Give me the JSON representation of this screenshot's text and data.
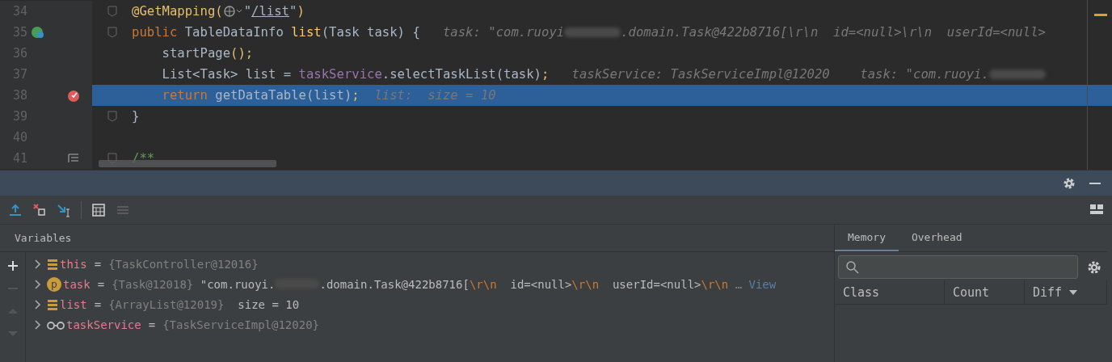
{
  "editor": {
    "lines": [
      {
        "number": "34",
        "kind": "plain",
        "fold": true,
        "current": false,
        "segments": [
          {
            "kind": "annotation",
            "text": "@GetMapping("
          },
          {
            "kind": "globe"
          },
          {
            "kind": "string",
            "text": "\""
          },
          {
            "kind": "link",
            "text": "/list"
          },
          {
            "kind": "string",
            "text": "\""
          },
          {
            "kind": "annotation",
            "text": ")"
          }
        ]
      },
      {
        "number": "35",
        "kind": "endpoint",
        "fold": true,
        "current": false,
        "segments": [
          {
            "kind": "keyword",
            "text": "public "
          },
          {
            "kind": "plain",
            "text": "TableDataInfo "
          },
          {
            "kind": "method",
            "text": "list"
          },
          {
            "kind": "plain",
            "text": "(Task task) "
          },
          {
            "kind": "brace",
            "text": "{"
          },
          {
            "kind": "hint",
            "text": "   task: \"com.ruoyi"
          },
          {
            "kind": "redacted"
          },
          {
            "kind": "hint",
            "text": ".domain.Task@422b8716[\\r\\n  id=<null>\\r\\n  userId=<null>"
          }
        ]
      },
      {
        "number": "36",
        "kind": "plain",
        "fold": false,
        "current": false,
        "segments": [
          {
            "kind": "plain",
            "text": "    startPage"
          },
          {
            "kind": "annotation",
            "text": "();"
          }
        ]
      },
      {
        "number": "37",
        "kind": "plain",
        "fold": false,
        "current": false,
        "segments": [
          {
            "kind": "plain",
            "text": "    List<Task> list = "
          },
          {
            "kind": "field",
            "text": "taskService"
          },
          {
            "kind": "plain",
            "text": ".selectTaskList(task)"
          },
          {
            "kind": "annotation",
            "text": ";"
          },
          {
            "kind": "hint",
            "text": "   taskService: TaskServiceImpl@12020    task: \"com.ruoyi."
          },
          {
            "kind": "redacted"
          }
        ]
      },
      {
        "number": "38",
        "kind": "breakpoint",
        "fold": false,
        "current": true,
        "segments": [
          {
            "kind": "keyword",
            "text": "    return "
          },
          {
            "kind": "plain",
            "text": "getDataTable(list)"
          },
          {
            "kind": "annotation",
            "text": ";"
          },
          {
            "kind": "hint",
            "text": "  list:  size = 10"
          }
        ]
      },
      {
        "number": "39",
        "kind": "plain",
        "fold": true,
        "current": false,
        "segments": [
          {
            "kind": "brace",
            "text": "}"
          }
        ]
      },
      {
        "number": "40",
        "kind": "plain",
        "fold": false,
        "current": false
      },
      {
        "number": "41",
        "kind": "doc",
        "fold": true,
        "current": false,
        "segments": [
          {
            "kind": "comment",
            "text": "/**"
          }
        ]
      }
    ]
  },
  "debug": {
    "variables_label": "Variables",
    "variables": [
      {
        "kind": "field",
        "name": "this",
        "equals": "=",
        "value": [
          {
            "kind": "ref",
            "text": "{TaskController@12016}"
          }
        ]
      },
      {
        "kind": "param",
        "badge": "p",
        "name": "task",
        "equals": "=",
        "value": [
          {
            "kind": "ref",
            "text": "{Task@12018}"
          },
          {
            "kind": "plain",
            "text": " \"com.ruoyi."
          },
          {
            "kind": "redacted"
          },
          {
            "kind": "plain",
            "text": ".domain.Task@422b8716["
          },
          {
            "kind": "escape",
            "text": "\\r\\n"
          },
          {
            "kind": "plain",
            "text": "  id=<null>"
          },
          {
            "kind": "escape",
            "text": "\\r\\n"
          },
          {
            "kind": "plain",
            "text": "  userId=<null>"
          },
          {
            "kind": "escape",
            "text": "\\r\\n"
          },
          {
            "kind": "ref",
            "text": " … "
          },
          {
            "kind": "link",
            "text": "View"
          }
        ]
      },
      {
        "kind": "field",
        "name": "list",
        "equals": "=",
        "value": [
          {
            "kind": "ref",
            "text": "{ArrayList@12019}"
          },
          {
            "kind": "plain",
            "text": "  size = 10"
          }
        ]
      },
      {
        "kind": "watch",
        "name": "taskService",
        "equals": "=",
        "value": [
          {
            "kind": "ref",
            "text": "{TaskServiceImpl@12020}"
          }
        ]
      }
    ],
    "memory": {
      "tabs": [
        {
          "label": "Memory",
          "selected": true
        },
        {
          "label": "Overhead",
          "selected": false
        }
      ],
      "columns": [
        {
          "label": "Class",
          "sort": false
        },
        {
          "label": "Count",
          "sort": false
        },
        {
          "label": "Diff",
          "sort": true
        }
      ]
    }
  }
}
